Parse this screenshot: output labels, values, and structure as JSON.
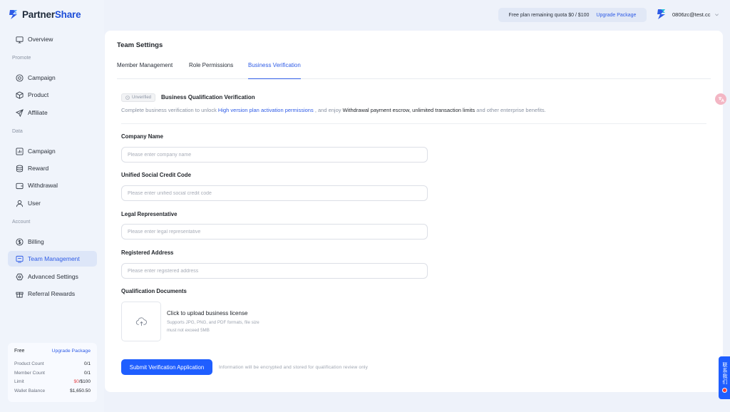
{
  "brand": {
    "name_part1": "Partner",
    "name_part2": "Share"
  },
  "colors": {
    "accent": "#2f5ce6",
    "primary_button": "#1f5eff",
    "active_nav_bg": "#dde6f8",
    "danger": "#e5484d"
  },
  "sidebar": {
    "sections": {
      "promote": "Promote",
      "data": "Data",
      "account": "Account"
    },
    "items": [
      {
        "label": "Overview",
        "icon": "monitor-icon"
      },
      {
        "label": "Campaign",
        "icon": "target-icon"
      },
      {
        "label": "Product",
        "icon": "box-icon"
      },
      {
        "label": "Affiliate",
        "icon": "send-icon"
      },
      {
        "label": "Campaign",
        "icon": "chart-icon"
      },
      {
        "label": "Reward",
        "icon": "database-icon"
      },
      {
        "label": "Withdrawal",
        "icon": "wallet-icon"
      },
      {
        "label": "User",
        "icon": "user-icon"
      },
      {
        "label": "Billing",
        "icon": "dollar-icon"
      },
      {
        "label": "Team Management",
        "icon": "team-icon",
        "active": true
      },
      {
        "label": "Advanced Settings",
        "icon": "settings-icon"
      },
      {
        "label": "Referral Rewards",
        "icon": "gift-icon"
      }
    ],
    "plan": {
      "name": "Free",
      "upgrade": "Upgrade Package",
      "rows": {
        "product_count_label": "Product Count",
        "product_count": "0/1",
        "member_count_label": "Member Count",
        "member_count": "0/1",
        "limit_label": "Limit",
        "limit_used": "$0",
        "limit_total": "/$100",
        "wallet_label": "Wallet Balance",
        "wallet": "$1,650.50"
      }
    }
  },
  "topbar": {
    "quota_text": "Free plan remaining quota $0 / $100",
    "upgrade": "Upgrade Package",
    "user_email": "0806zc@test.cc"
  },
  "main": {
    "title": "Team Settings",
    "tabs": [
      "Member Management",
      "Role Permissions",
      "Business Verification"
    ],
    "active_tab": 2,
    "verification": {
      "badge": "Unverified",
      "title": "Business Qualification Verification",
      "intro_1": "Complete business verification to unlock ",
      "intro_link": "High version plan activation permissions",
      "intro_2": " , and enjoy ",
      "intro_bold": "Withdrawal payment escrow, unlimited transaction limits",
      "intro_3": " and other enterprise benefits."
    },
    "fields": [
      {
        "label": "Company Name",
        "placeholder": "Please enter company name",
        "value": ""
      },
      {
        "label": "Unified Social Credit Code",
        "placeholder": "Please enter unified social credit code",
        "value": ""
      },
      {
        "label": "Legal Representative",
        "placeholder": "Please enter legal representative",
        "value": ""
      },
      {
        "label": "Registered Address",
        "placeholder": "Please enter registered address",
        "value": ""
      }
    ],
    "documents": {
      "label": "Qualification Documents",
      "upload_title": "Click to upload business license",
      "upload_hint": "Supports JPG, PNG, and PDF formats, file size must not exceed 5MB"
    },
    "submit": "Submit Verification Application",
    "submit_note": "Information will be encrypted and stored for qualification review only"
  },
  "widgets": {
    "contact": "联系我们",
    "translate_icon": "translate-icon"
  }
}
